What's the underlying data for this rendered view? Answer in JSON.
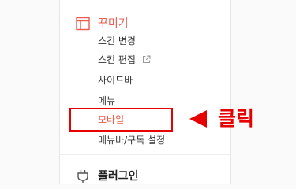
{
  "sidebar": {
    "section_title": "꾸미기",
    "items": [
      {
        "label": "스킨 변경"
      },
      {
        "label": "스킨 편집"
      },
      {
        "label": "사이드바"
      },
      {
        "label": "메뉴"
      },
      {
        "label": "모바일"
      },
      {
        "label": "메뉴바/구독 설정"
      }
    ],
    "plugin_title": "플러그인"
  },
  "annotation": {
    "label": "클릭"
  },
  "colors": {
    "accent": "#eb5a4b",
    "annotation": "#e60000",
    "text": "#333333"
  },
  "icons": {
    "section": "layout-icon",
    "external": "external-link-icon",
    "plugin": "plug-icon",
    "pointer": "left-arrow-icon"
  }
}
